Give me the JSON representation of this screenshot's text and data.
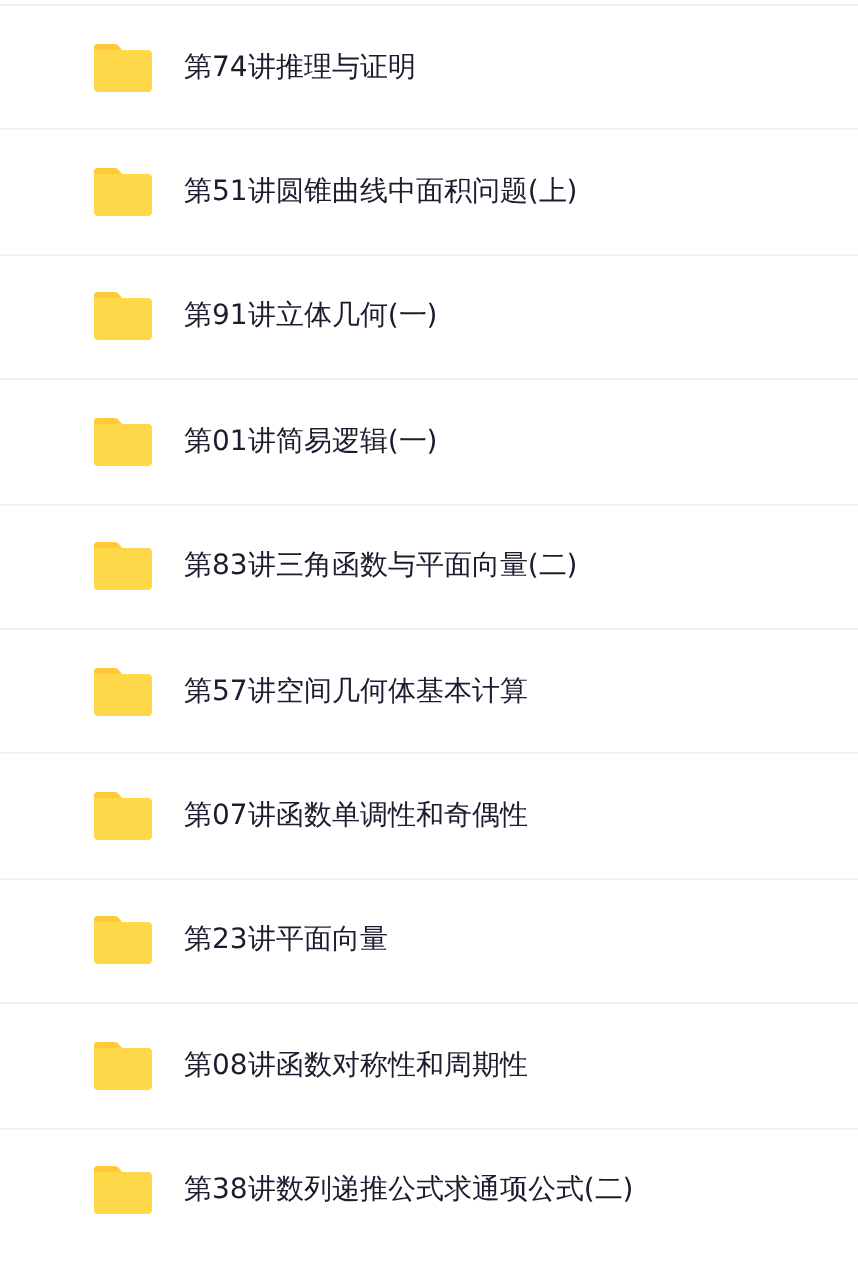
{
  "folders": [
    {
      "name": "第74讲推理与证明"
    },
    {
      "name": "第51讲圆锥曲线中面积问题(上)"
    },
    {
      "name": "第91讲立体几何(一)"
    },
    {
      "name": "第01讲简易逻辑(一)"
    },
    {
      "name": "第83讲三角函数与平面向量(二)"
    },
    {
      "name": "第57讲空间几何体基本计算"
    },
    {
      "name": "第07讲函数单调性和奇偶性"
    },
    {
      "name": "第23讲平面向量"
    },
    {
      "name": "第08讲函数对称性和周期性"
    },
    {
      "name": "第38讲数列递推公式求通项公式(二)"
    }
  ]
}
